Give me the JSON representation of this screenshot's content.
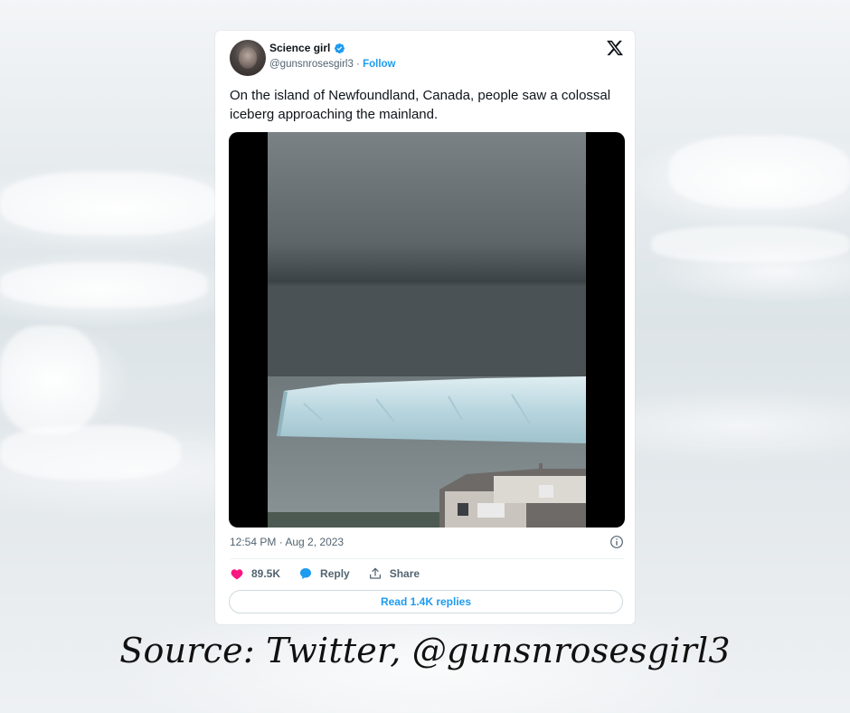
{
  "tweet": {
    "display_name": "Science girl",
    "handle": "@gunsnrosesgirl3",
    "separator": " · ",
    "follow_label": "Follow",
    "text": "On the island of Newfoundland, Canada, people saw a colossal iceberg approaching the mainland.",
    "timestamp": "12:54 PM · Aug 2, 2023",
    "likes": "89.5K",
    "reply_label": "Reply",
    "share_label": "Share",
    "read_replies_label": "Read 1.4K replies"
  },
  "caption": "Source: Twitter, @gunsnrosesgirl3",
  "icons": {
    "verified": "verified-badge-icon",
    "x_logo": "x-logo-icon",
    "info": "info-icon",
    "like": "heart-icon",
    "reply": "speech-bubble-icon",
    "share": "share-icon"
  },
  "colors": {
    "accent": "#1d9bf0",
    "like": "#f91880",
    "text": "#0f1419",
    "muted": "#536471"
  }
}
